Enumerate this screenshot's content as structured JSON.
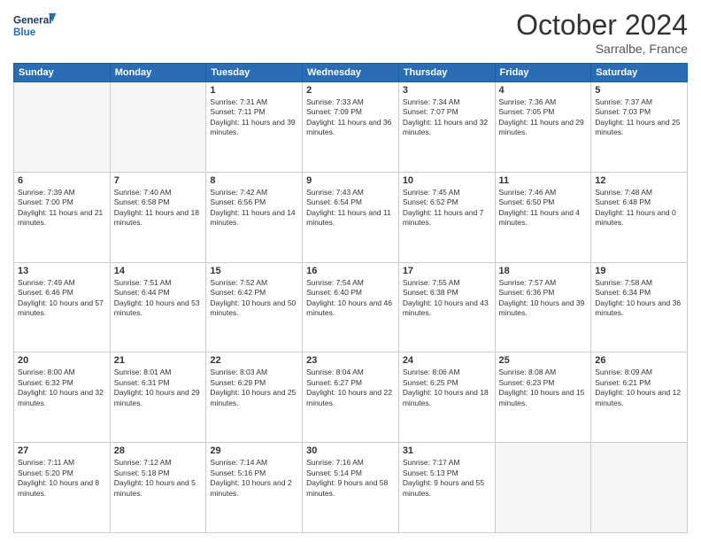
{
  "header": {
    "logo_line1": "General",
    "logo_line2": "Blue",
    "month_title": "October 2024",
    "location": "Sarralbe, France"
  },
  "weekdays": [
    "Sunday",
    "Monday",
    "Tuesday",
    "Wednesday",
    "Thursday",
    "Friday",
    "Saturday"
  ],
  "weeks": [
    [
      {
        "day": "",
        "empty": true
      },
      {
        "day": "",
        "empty": true
      },
      {
        "day": "1",
        "sunrise": "7:31 AM",
        "sunset": "7:11 PM",
        "daylight": "11 hours and 39 minutes."
      },
      {
        "day": "2",
        "sunrise": "7:33 AM",
        "sunset": "7:09 PM",
        "daylight": "11 hours and 36 minutes."
      },
      {
        "day": "3",
        "sunrise": "7:34 AM",
        "sunset": "7:07 PM",
        "daylight": "11 hours and 32 minutes."
      },
      {
        "day": "4",
        "sunrise": "7:36 AM",
        "sunset": "7:05 PM",
        "daylight": "11 hours and 29 minutes."
      },
      {
        "day": "5",
        "sunrise": "7:37 AM",
        "sunset": "7:03 PM",
        "daylight": "11 hours and 25 minutes."
      }
    ],
    [
      {
        "day": "6",
        "sunrise": "7:39 AM",
        "sunset": "7:00 PM",
        "daylight": "11 hours and 21 minutes."
      },
      {
        "day": "7",
        "sunrise": "7:40 AM",
        "sunset": "6:58 PM",
        "daylight": "11 hours and 18 minutes."
      },
      {
        "day": "8",
        "sunrise": "7:42 AM",
        "sunset": "6:56 PM",
        "daylight": "11 hours and 14 minutes."
      },
      {
        "day": "9",
        "sunrise": "7:43 AM",
        "sunset": "6:54 PM",
        "daylight": "11 hours and 11 minutes."
      },
      {
        "day": "10",
        "sunrise": "7:45 AM",
        "sunset": "6:52 PM",
        "daylight": "11 hours and 7 minutes."
      },
      {
        "day": "11",
        "sunrise": "7:46 AM",
        "sunset": "6:50 PM",
        "daylight": "11 hours and 4 minutes."
      },
      {
        "day": "12",
        "sunrise": "7:48 AM",
        "sunset": "6:48 PM",
        "daylight": "11 hours and 0 minutes."
      }
    ],
    [
      {
        "day": "13",
        "sunrise": "7:49 AM",
        "sunset": "6:46 PM",
        "daylight": "10 hours and 57 minutes."
      },
      {
        "day": "14",
        "sunrise": "7:51 AM",
        "sunset": "6:44 PM",
        "daylight": "10 hours and 53 minutes."
      },
      {
        "day": "15",
        "sunrise": "7:52 AM",
        "sunset": "6:42 PM",
        "daylight": "10 hours and 50 minutes."
      },
      {
        "day": "16",
        "sunrise": "7:54 AM",
        "sunset": "6:40 PM",
        "daylight": "10 hours and 46 minutes."
      },
      {
        "day": "17",
        "sunrise": "7:55 AM",
        "sunset": "6:38 PM",
        "daylight": "10 hours and 43 minutes."
      },
      {
        "day": "18",
        "sunrise": "7:57 AM",
        "sunset": "6:36 PM",
        "daylight": "10 hours and 39 minutes."
      },
      {
        "day": "19",
        "sunrise": "7:58 AM",
        "sunset": "6:34 PM",
        "daylight": "10 hours and 36 minutes."
      }
    ],
    [
      {
        "day": "20",
        "sunrise": "8:00 AM",
        "sunset": "6:32 PM",
        "daylight": "10 hours and 32 minutes."
      },
      {
        "day": "21",
        "sunrise": "8:01 AM",
        "sunset": "6:31 PM",
        "daylight": "10 hours and 29 minutes."
      },
      {
        "day": "22",
        "sunrise": "8:03 AM",
        "sunset": "6:29 PM",
        "daylight": "10 hours and 25 minutes."
      },
      {
        "day": "23",
        "sunrise": "8:04 AM",
        "sunset": "6:27 PM",
        "daylight": "10 hours and 22 minutes."
      },
      {
        "day": "24",
        "sunrise": "8:06 AM",
        "sunset": "6:25 PM",
        "daylight": "10 hours and 18 minutes."
      },
      {
        "day": "25",
        "sunrise": "8:08 AM",
        "sunset": "6:23 PM",
        "daylight": "10 hours and 15 minutes."
      },
      {
        "day": "26",
        "sunrise": "8:09 AM",
        "sunset": "6:21 PM",
        "daylight": "10 hours and 12 minutes."
      }
    ],
    [
      {
        "day": "27",
        "sunrise": "7:11 AM",
        "sunset": "5:20 PM",
        "daylight": "10 hours and 8 minutes."
      },
      {
        "day": "28",
        "sunrise": "7:12 AM",
        "sunset": "5:18 PM",
        "daylight": "10 hours and 5 minutes."
      },
      {
        "day": "29",
        "sunrise": "7:14 AM",
        "sunset": "5:16 PM",
        "daylight": "10 hours and 2 minutes."
      },
      {
        "day": "30",
        "sunrise": "7:16 AM",
        "sunset": "5:14 PM",
        "daylight": "9 hours and 58 minutes."
      },
      {
        "day": "31",
        "sunrise": "7:17 AM",
        "sunset": "5:13 PM",
        "daylight": "9 hours and 55 minutes."
      },
      {
        "day": "",
        "empty": true
      },
      {
        "day": "",
        "empty": true
      }
    ]
  ]
}
